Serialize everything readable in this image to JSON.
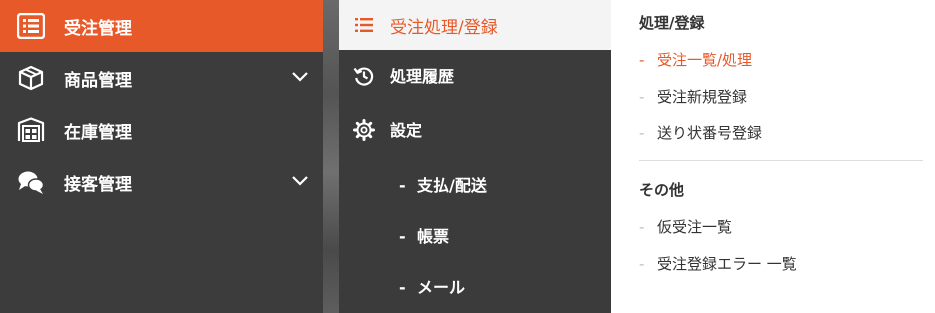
{
  "main_nav": {
    "items": [
      {
        "label": "受注管理",
        "icon": "list-icon",
        "active": true,
        "expandable": false
      },
      {
        "label": "商品管理",
        "icon": "box-icon",
        "active": false,
        "expandable": true
      },
      {
        "label": "在庫管理",
        "icon": "warehouse-icon",
        "active": false,
        "expandable": false
      },
      {
        "label": "接客管理",
        "icon": "chat-bubbles-icon",
        "active": false,
        "expandable": true
      }
    ]
  },
  "sub_nav": {
    "header": {
      "label": "受注処理/登録",
      "icon": "list-lines-icon"
    },
    "items": [
      {
        "label": "処理履歴",
        "icon": "history-icon"
      },
      {
        "label": "設定",
        "icon": "gear-icon"
      }
    ],
    "settings_children": [
      {
        "dash": "-",
        "label": "支払/配送"
      },
      {
        "dash": "-",
        "label": "帳票"
      },
      {
        "dash": "-",
        "label": "メール"
      }
    ]
  },
  "panel": {
    "section1": {
      "title": "処理/登録",
      "items": [
        {
          "dash": "-",
          "label": "受注一覧/処理",
          "current": true
        },
        {
          "dash": "-",
          "label": "受注新規登録",
          "current": false
        },
        {
          "dash": "-",
          "label": "送り状番号登録",
          "current": false
        }
      ]
    },
    "section2": {
      "title": "その他",
      "items": [
        {
          "dash": "-",
          "label": "仮受注一覧"
        },
        {
          "dash": "-",
          "label": "受注登録エラー 一覧"
        }
      ]
    }
  },
  "colors": {
    "accent": "#e8592a",
    "nav_bg": "#3c3c3c",
    "panel_bg": "#ffffff"
  }
}
